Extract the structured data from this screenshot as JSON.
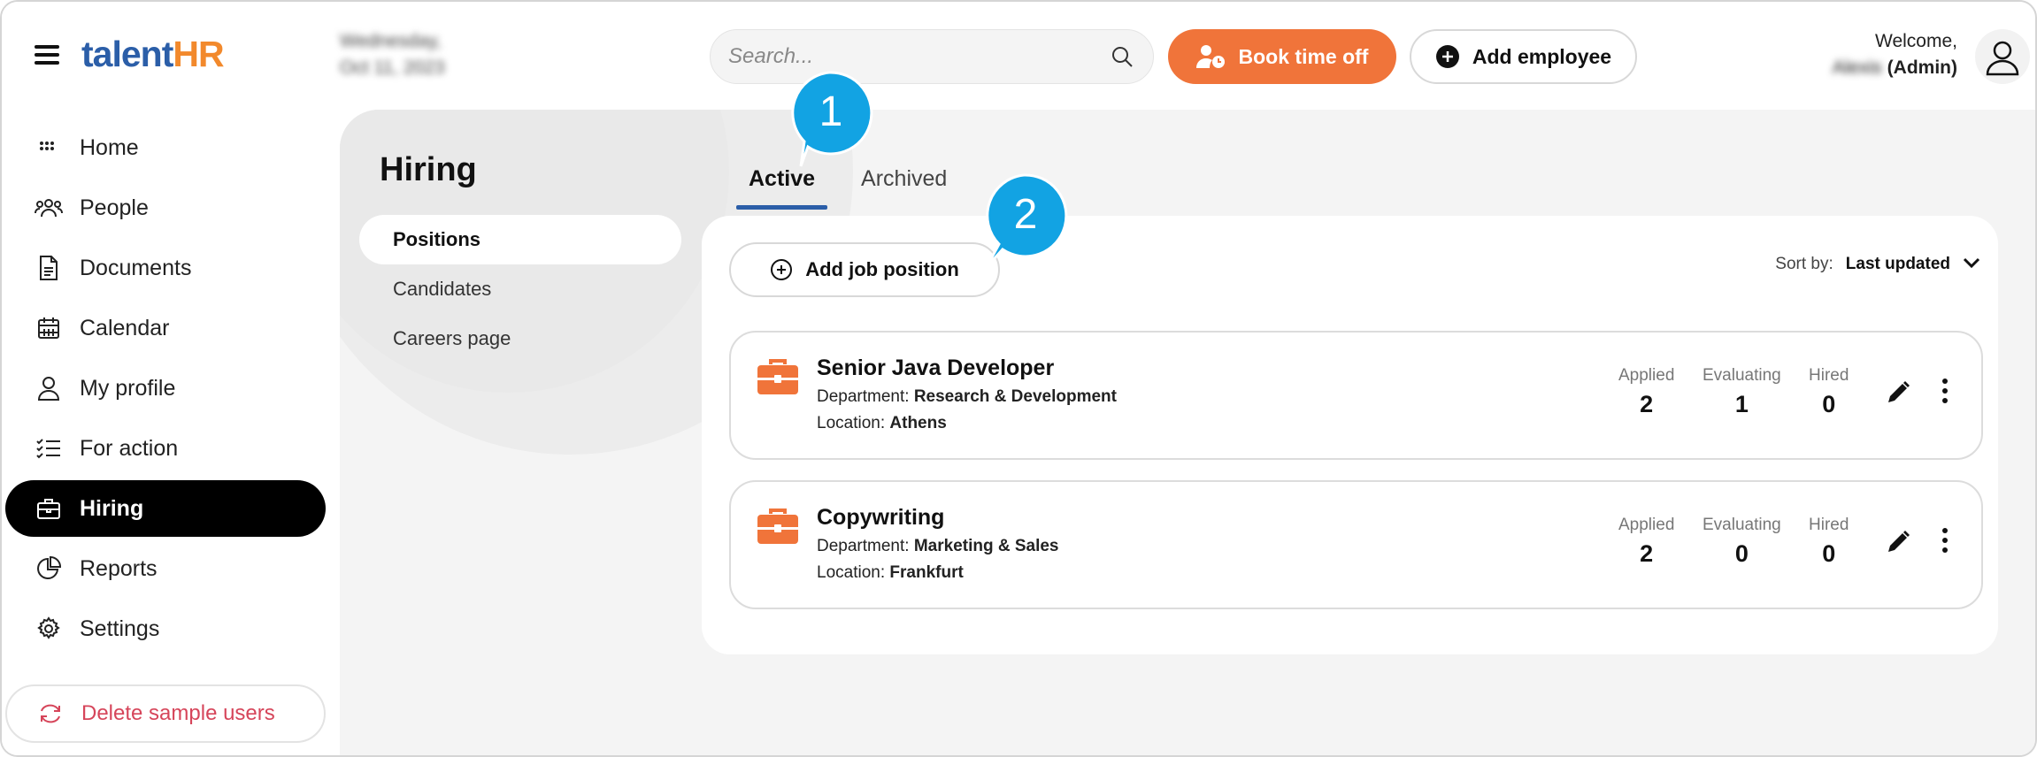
{
  "app": {
    "logo_talent": "talent",
    "logo_hr": "HR"
  },
  "topbar": {
    "date_line1": "Wednesday,",
    "date_line2": "Oct 11, 2023",
    "search_placeholder": "Search...",
    "book_time_off": "Book time off",
    "add_employee": "Add employee",
    "welcome": "Welcome,",
    "user_name": "Alexis",
    "user_role": "(Admin)"
  },
  "sidebar": {
    "items": [
      {
        "label": "Home",
        "icon": "grid-icon"
      },
      {
        "label": "People",
        "icon": "people-icon"
      },
      {
        "label": "Documents",
        "icon": "document-icon"
      },
      {
        "label": "Calendar",
        "icon": "calendar-icon"
      },
      {
        "label": "My profile",
        "icon": "user-icon"
      },
      {
        "label": "For action",
        "icon": "checklist-icon"
      },
      {
        "label": "Hiring",
        "icon": "briefcase-icon",
        "active": true
      },
      {
        "label": "Reports",
        "icon": "pie-chart-icon"
      },
      {
        "label": "Settings",
        "icon": "gear-icon"
      }
    ],
    "delete_sample_users": "Delete sample users"
  },
  "hiring": {
    "title": "Hiring",
    "subnav": [
      "Positions",
      "Candidates",
      "Careers page"
    ],
    "tabs": [
      "Active",
      "Archived"
    ],
    "add_job_position": "Add job position",
    "sort_label": "Sort by:",
    "sort_value": "Last updated",
    "stat_labels": {
      "applied": "Applied",
      "evaluating": "Evaluating",
      "hired": "Hired"
    },
    "department_label": "Department:",
    "location_label": "Location:",
    "jobs": [
      {
        "title": "Senior Java Developer",
        "department": "Research & Development",
        "location": "Athens",
        "applied": "2",
        "evaluating": "1",
        "hired": "0"
      },
      {
        "title": "Copywriting",
        "department": "Marketing & Sales",
        "location": "Frankfurt",
        "applied": "2",
        "evaluating": "0",
        "hired": "0"
      }
    ]
  },
  "callouts": {
    "one": "1",
    "two": "2"
  },
  "colors": {
    "accent_orange": "#f0743a",
    "brand_blue": "#2b5ea8",
    "callout_blue": "#12a3e3",
    "danger": "#d6455a"
  }
}
